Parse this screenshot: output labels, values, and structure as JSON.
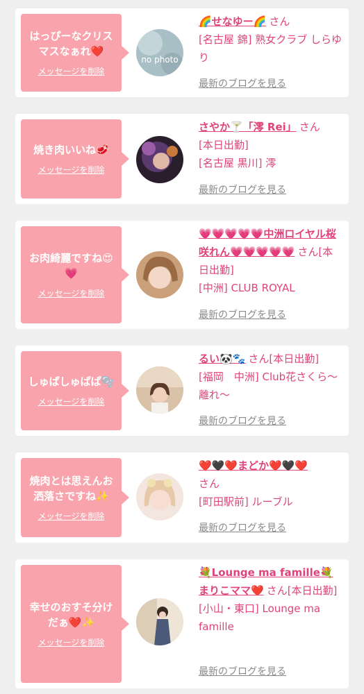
{
  "delete_label": "メッセージを削除",
  "blog_label": "最新のブログを見る",
  "san_label": "さん",
  "items": [
    {
      "message": "はっぴーなクリスマスなぁれ❤️",
      "name": "🌈せなゆー🌈",
      "location": "[名古屋 錦] 熟女クラブ しらゆり",
      "working_today": "",
      "avatar_text": "no photo"
    },
    {
      "message": "焼き肉いいね🥩",
      "name": "さやか🍸「澪 Rei」",
      "working_today": "[本日出勤]",
      "location": "[名古屋 黒川] 澪"
    },
    {
      "message": "お肉綺麗ですね😍💗",
      "name": "💗💗💗💗💗中洲ロイヤル桜咲れん💗💗💗💗💗",
      "working_today": "[本日出勤]",
      "location": "[中洲] CLUB ROYAL"
    },
    {
      "message": "しゅぱしゅぱぱ🫧",
      "name": "るい🐼🐾",
      "working_today": "[本日出勤]",
      "location": "[福岡　中洲] Club花さくら～離れ～"
    },
    {
      "message": "焼肉とは思えんお洒落さですね✨",
      "name": "❤️🖤❤️まどか❤️🖤❤️",
      "working_today": "",
      "location": "[町田駅前] ルーブル"
    },
    {
      "message": "幸せのおすそ分けだぁ❤️✨",
      "name": "💐Lounge ma famille💐まりこママ❤️",
      "working_today": "[本日出勤]",
      "location": "[小山・東口] Lounge ma famille"
    }
  ],
  "colors": {
    "page_bg": "#efefef",
    "bubble_bg": "#f9a4ad",
    "name_pink": "#e0437b",
    "link_gray": "#8a8a8a"
  }
}
